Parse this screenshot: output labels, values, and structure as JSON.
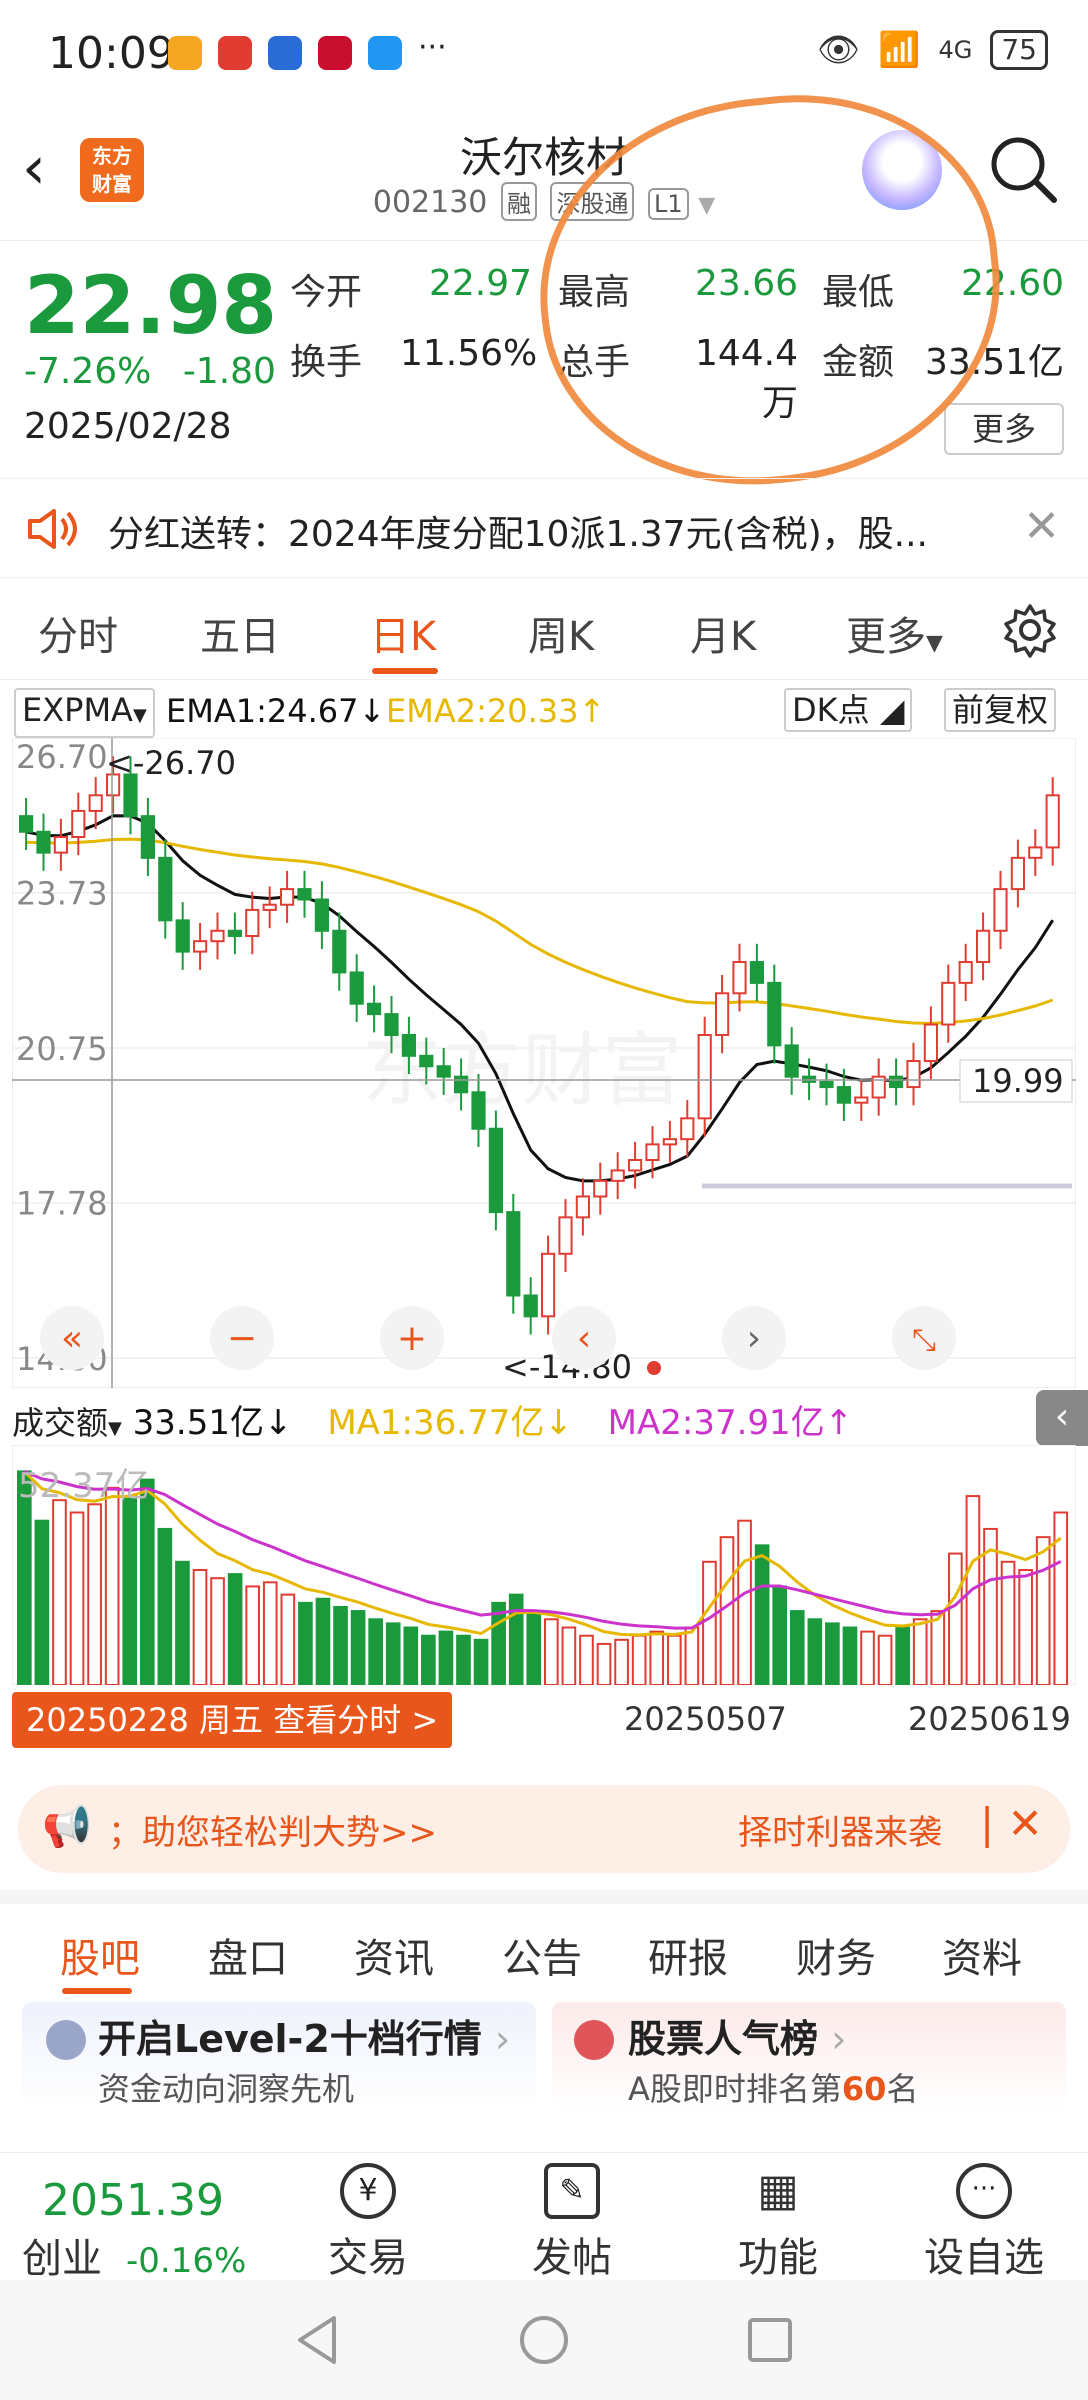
{
  "status_bar": {
    "time": "10:09",
    "network": "4G",
    "battery": "75",
    "more": "···"
  },
  "header": {
    "back_icon": "chevron-left-icon",
    "logo_line1": "东方",
    "logo_line2": "财富",
    "title": "沃尔核材",
    "code": "002130",
    "tags": [
      "融",
      "深股通",
      "L1"
    ]
  },
  "quote": {
    "price": "22.98",
    "change_pct": "-7.26%",
    "change": "-1.80",
    "date": "2025/02/28",
    "fields": [
      {
        "label": "今开",
        "value": "22.97"
      },
      {
        "label": "最高",
        "value": "23.66"
      },
      {
        "label": "最低",
        "value": "22.60"
      },
      {
        "label": "换手",
        "value": "11.56%"
      },
      {
        "label": "总手",
        "value": "144.4万"
      },
      {
        "label": "金额",
        "value": "33.51亿"
      }
    ],
    "more_label": "更多"
  },
  "notice": {
    "text": "分红送转：2024年度分配10派1.37元(含税)，股..."
  },
  "kline_tabs": {
    "items": [
      "分时",
      "五日",
      "日K",
      "周K",
      "月K",
      "更多"
    ],
    "active": "日K"
  },
  "indicators": {
    "main": "EXPMA",
    "ema1": "EMA1:24.67",
    "ema2": "EMA2:20.33",
    "dk": "DK点",
    "adjust": "前复权"
  },
  "chart_data": {
    "type": "candlestick",
    "y_ticks": [
      "26.70",
      "23.73",
      "20.75",
      "17.78",
      "14.80"
    ],
    "ylim": [
      14.8,
      26.7
    ],
    "max_label": "<-26.70",
    "min_label": "<-14.80",
    "last_label": "19.99",
    "volume": {
      "label": "成交额",
      "value": "33.51亿",
      "ma1": "MA1:36.77亿",
      "ma2": "MA2:37.91亿",
      "max_label": "52.37亿"
    },
    "x_labels": [
      "20250507",
      "20250619"
    ],
    "selected_date_label": "20250228 周五 查看分时 >"
  },
  "promo": {
    "text_left": "；助您轻松判大势>>",
    "text_right": "择时利器来袭"
  },
  "bottom_tabs": {
    "items": [
      "股吧",
      "盘口",
      "资讯",
      "公告",
      "研报",
      "财务",
      "资料"
    ],
    "active": "股吧"
  },
  "cards": [
    {
      "title": "开启Level-2十档行情",
      "sub": "资金动向洞察先机"
    },
    {
      "title": "股票人气榜",
      "sub_prefix": "A股即时排名第",
      "rank": "60",
      "sub_suffix": "名"
    }
  ],
  "bottom_nav": {
    "index_value": "2051.39",
    "index_name": "创业",
    "index_change": "-0.16%",
    "items": [
      "交易",
      "发帖",
      "功能",
      "设自选"
    ]
  },
  "colors": {
    "accent": "#e8561c",
    "up": "#e03c31",
    "down": "#1a9a3c",
    "ema1": "#111111",
    "ema2": "#e6b800",
    "ma2": "#cc33cc",
    "annotation": "#f08a3e"
  }
}
